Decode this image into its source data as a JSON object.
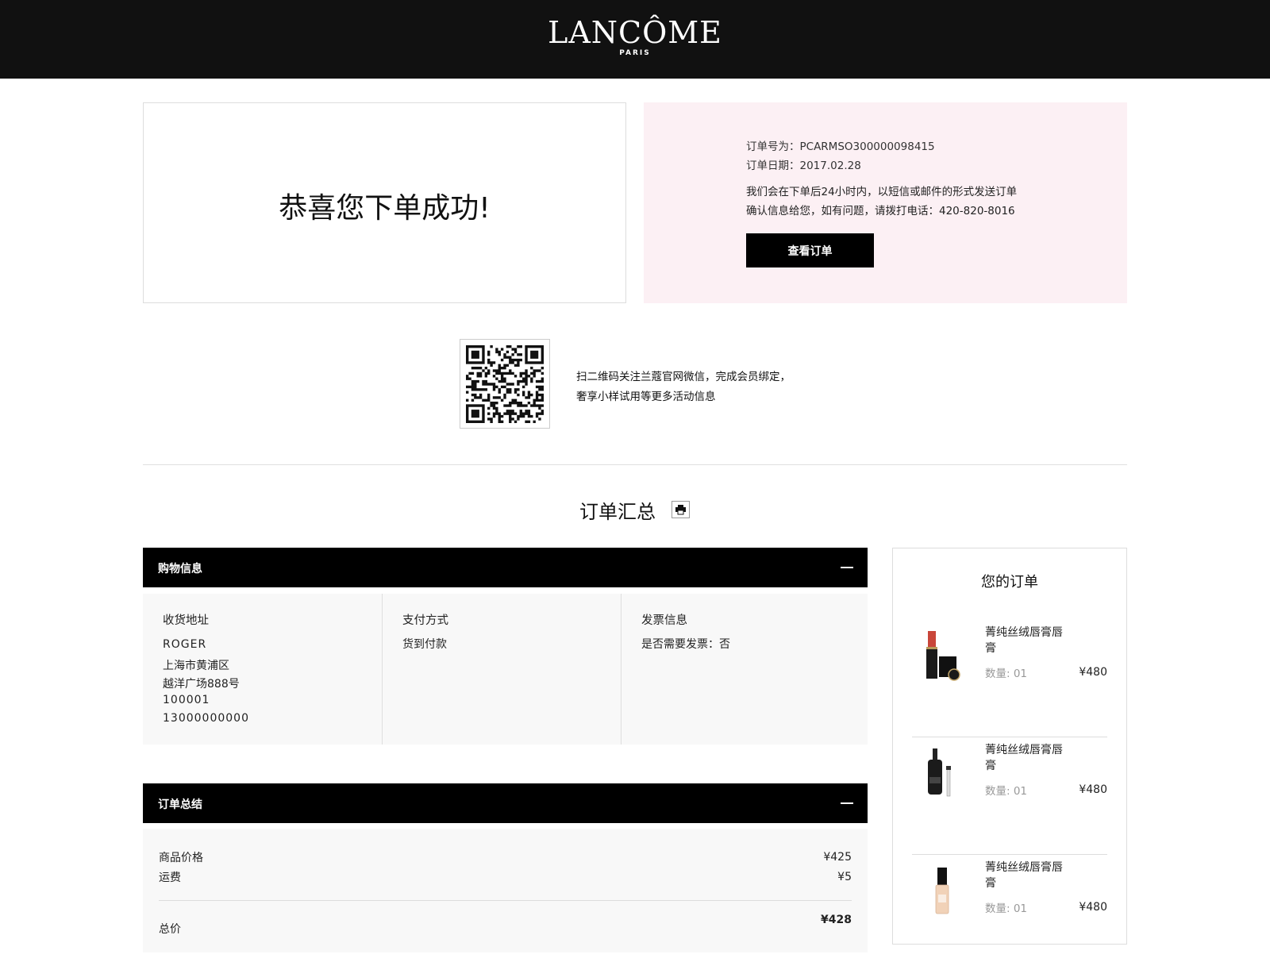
{
  "header": {
    "brand": "LANCÔME",
    "brand_sub": "PARIS"
  },
  "success": {
    "message": "恭喜您下单成功!"
  },
  "order_info": {
    "order_number_line": "订单号为：PCARMSO300000098415",
    "order_date_line": "订单日期：2017.02.28",
    "notice_line1": "我们会在下单后24小时内，以短信或邮件的形式发送订单",
    "notice_line2": "确认信息给您，如有问题，请拨打电话：420-820-8016",
    "view_order_label": "查看订单"
  },
  "wechat": {
    "line1": "扫二维码关注兰蔻官网微信，完成会员绑定，",
    "line2": "奢享小样试用等更多活动信息"
  },
  "summary": {
    "title": "订单汇总"
  },
  "shopping_info": {
    "bar_label": "购物信息",
    "address_title": "收货地址",
    "address_lines": [
      "ROGER",
      "上海市黄浦区",
      "越洋广场888号",
      "100001",
      "13000000000"
    ],
    "payment_title": "支付方式",
    "payment_value": "货到付款",
    "invoice_title": "发票信息",
    "invoice_value": "是否需要发票：否"
  },
  "order_totals": {
    "bar_label": "订单总结",
    "rows": [
      {
        "label": "商品价格",
        "value": "¥425"
      },
      {
        "label": "运费",
        "value": "¥5"
      }
    ],
    "total_label": "总价",
    "total_value": "¥428"
  },
  "your_order": {
    "title": "您的订单",
    "items": [
      {
        "name": "菁纯丝绒唇膏唇膏",
        "qty": "数量: 01",
        "price": "¥480",
        "thumb": "lipstick-icon"
      },
      {
        "name": "菁纯丝绒唇膏唇膏",
        "qty": "数量: 01",
        "price": "¥480",
        "thumb": "serum-bottle-icon"
      },
      {
        "name": "菁纯丝绒唇膏唇膏",
        "qty": "数量: 01",
        "price": "¥480",
        "thumb": "foundation-bottle-icon"
      }
    ]
  },
  "colors": {
    "header_bg": "#111111",
    "info_bg": "#fcf0f4",
    "bar_bg": "#000000",
    "panel_bg": "#f8f8f8"
  }
}
